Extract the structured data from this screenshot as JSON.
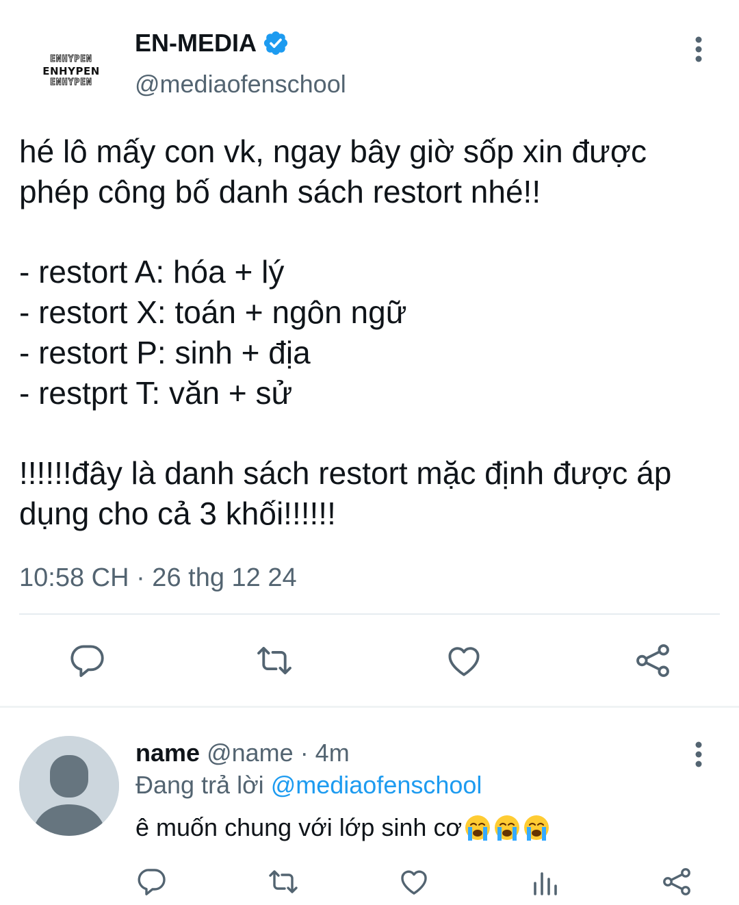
{
  "tweet": {
    "logo_lines": [
      "ENHYPEN",
      "ENHYPEN",
      "ENHYPEN"
    ],
    "display_name": "EN-MEDIA",
    "handle": "@mediaofenschool",
    "lines": [
      "hé lô mấy con vk, ngay bây giờ sốp xin được",
      "phép công bố danh sách restort nhé!!",
      "",
      "- restort A: hóa + lý",
      "- restort X: toán + ngôn ngữ",
      "- restort P: sinh + địa",
      "- restprt T: văn + sử",
      "",
      "!!!!!!đây là danh sách restort mặc định được áp",
      "dụng cho cả 3 khối!!!!!!"
    ],
    "timestamp": "10:58 CH · 26 thg 12 24",
    "actions": [
      "reply-icon",
      "retweet-icon",
      "like-icon",
      "share-icon"
    ]
  },
  "reply": {
    "name": "name",
    "handle": "@name",
    "time": "· 4m",
    "replying_prefix": "Đang trả lời",
    "replying_to": "@mediaofenschool",
    "text": "ê muốn chung với lớp sinh cơ",
    "emojis": [
      "loudly-crying-face-icon",
      "loudly-crying-face-icon",
      "loudly-crying-face-icon"
    ],
    "actions": [
      "reply-icon",
      "retweet-icon",
      "like-icon",
      "analytics-icon",
      "share-icon"
    ]
  },
  "colors": {
    "text": "#0f1419",
    "secondary": "#536471",
    "accent": "#1d9bf0",
    "divider": "#e6ecf0"
  }
}
